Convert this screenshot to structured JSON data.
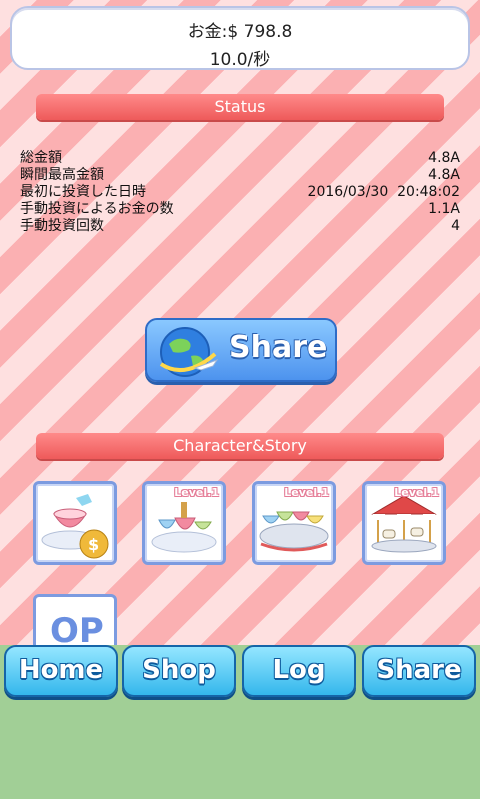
{
  "header": {
    "money_label": "お金:$ 798.8",
    "rate_label": "10.0/秒"
  },
  "status": {
    "title": "Status",
    "rows": [
      {
        "label": "総金額",
        "value": "4.8A"
      },
      {
        "label": "瞬間最高金額",
        "value": "4.8A"
      },
      {
        "label": "最初に投資した日時",
        "value": "2016/03/30  20:48:02"
      },
      {
        "label": "手動投資によるお金の数",
        "value": "1.1A"
      },
      {
        "label": "手動投資回数",
        "value": "4"
      }
    ]
  },
  "share_main": {
    "label": "Share",
    "icon": "globe-airplane-icon"
  },
  "characters": {
    "title": "Character&Story",
    "cards": [
      {
        "icon": "teacup-money-bag-icon",
        "level": ""
      },
      {
        "icon": "teacup-ride-icon",
        "level": "Level.1"
      },
      {
        "icon": "teacup-carousel-icon",
        "level": "Level.1"
      },
      {
        "icon": "merry-go-round-icon",
        "level": "Level.1"
      }
    ],
    "partial_card_text": "OP"
  },
  "nav": {
    "home": "Home",
    "shop": "Shop",
    "log": "Log",
    "share": "Share"
  }
}
